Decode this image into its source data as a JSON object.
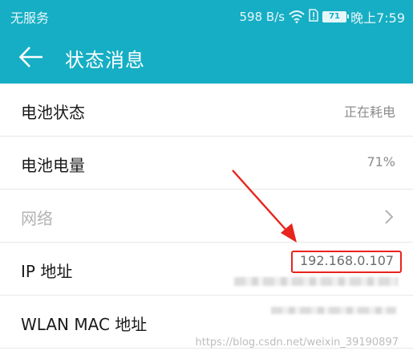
{
  "status_bar": {
    "carrier": "无服务",
    "net_speed": "598 B/s",
    "battery_level": "71",
    "time": "晚上7:59",
    "icons": [
      "wifi-icon",
      "sim-alert-icon",
      "battery-icon"
    ]
  },
  "app_bar": {
    "title": "状态消息",
    "back_icon": "arrow-left-icon"
  },
  "rows": [
    {
      "label": "电池状态",
      "value": "正在耗电"
    },
    {
      "label": "电池电量",
      "value": "71%"
    },
    {
      "label": "网络",
      "value": ""
    },
    {
      "label": "IP 地址",
      "value": "192.168.0.107"
    },
    {
      "label": "WLAN MAC 地址",
      "value": ""
    }
  ],
  "watermark": "https://blog.csdn.net/weixin_39190897",
  "colors": {
    "primary": "#16aec4",
    "annotation_red": "#e8241e",
    "text": "#1a1a1a",
    "muted": "#8c8c8c",
    "disabled": "#b3b3b3"
  }
}
